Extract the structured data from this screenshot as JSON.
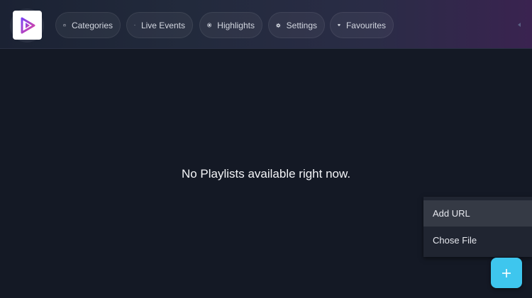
{
  "header": {
    "nav": [
      {
        "label": "Categories",
        "icon": "tv-icon"
      },
      {
        "label": "Live Events",
        "icon": "broadcast-icon"
      },
      {
        "label": "Highlights",
        "icon": "record-icon"
      },
      {
        "label": "Settings",
        "icon": "gear-icon"
      },
      {
        "label": "Favourites",
        "icon": "heart-icon"
      }
    ]
  },
  "main": {
    "empty_message": "No Playlists available right now."
  },
  "add_menu": {
    "items": [
      {
        "label": "Add URL",
        "highlighted": true
      },
      {
        "label": "Chose File",
        "highlighted": false
      }
    ]
  },
  "fab": {
    "icon": "plus-icon"
  },
  "colors": {
    "accent": "#3ec6ee",
    "background": "#141925",
    "logo_gradient": [
      "#7b3ff2",
      "#e0459c"
    ]
  }
}
